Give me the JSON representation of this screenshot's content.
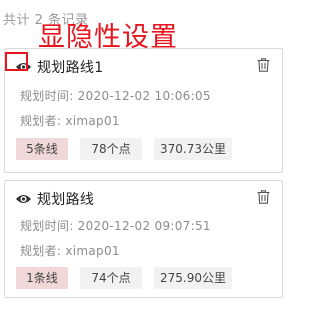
{
  "summary": "共计 2 条记录",
  "annotation": "显隐性设置",
  "icons": {
    "visibility": "eye-icon",
    "delete": "trash-icon"
  },
  "colors": {
    "annotation": "#e8141e",
    "line_count_tag": "#f0d7d8"
  },
  "routes": [
    {
      "name": "规划路线1",
      "time_label": "规划时间: ",
      "time": "2020-12-02 10:06:05",
      "author_label": "规划者: ",
      "author": "ximap01",
      "lines": "5条线",
      "points": "78个点",
      "distance": "370.73公里"
    },
    {
      "name": "规划路线",
      "time_label": "规划时间: ",
      "time": "2020-12-02 09:07:51",
      "author_label": "规划者: ",
      "author": "ximap01",
      "lines": "1条线",
      "points": "74个点",
      "distance": "275.90公里"
    }
  ]
}
